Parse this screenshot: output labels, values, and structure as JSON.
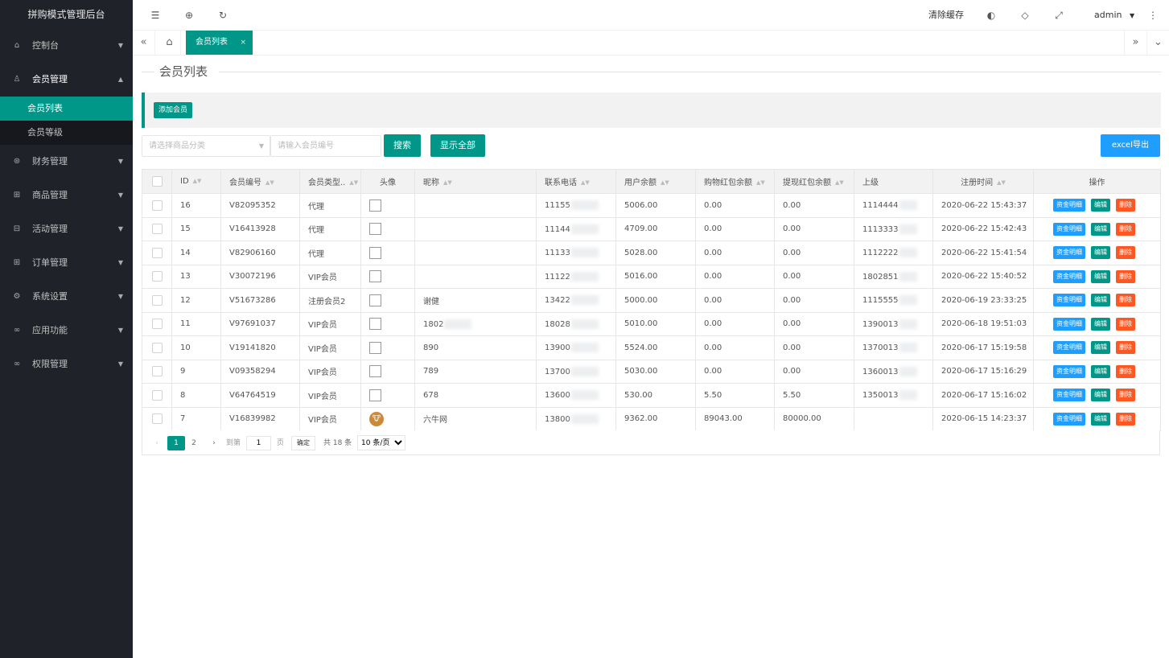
{
  "app_title": "拼购模式管理后台",
  "sidebar": {
    "items": [
      {
        "label": "控制台",
        "icon": "⌂"
      },
      {
        "label": "会员管理",
        "icon": "♙"
      },
      {
        "label": "财务管理",
        "icon": "⊛"
      },
      {
        "label": "商品管理",
        "icon": "⊞"
      },
      {
        "label": "活动管理",
        "icon": "⊟"
      },
      {
        "label": "订单管理",
        "icon": "⊞"
      },
      {
        "label": "系统设置",
        "icon": "⚙"
      },
      {
        "label": "应用功能",
        "icon": "∞"
      },
      {
        "label": "权限管理",
        "icon": "∞"
      }
    ],
    "submenu": [
      "会员列表",
      "会员等级"
    ]
  },
  "topbar": {
    "clear_cache": "清除缓存",
    "user": "admin",
    "menu_icon": "☰",
    "globe_icon": "⊕",
    "refresh_icon": "↻"
  },
  "tabs": {
    "active": "会员列表",
    "close": "×"
  },
  "page": {
    "title": "会员列表",
    "add_button": "添加会员",
    "category_placeholder": "请选择商品分类",
    "member_placeholder": "请输入会员编号",
    "search_button": "搜索",
    "show_all_button": "显示全部",
    "export_button": "excel导出"
  },
  "table": {
    "headers": [
      "ID",
      "会员编号",
      "会员类型..",
      "头像",
      "昵称",
      "联系电话",
      "用户余额",
      "购物红包余额",
      "提现红包余额",
      "上级",
      "注册时间",
      "操作"
    ],
    "rows": [
      {
        "id": "16",
        "code": "V82095352",
        "type": "代理",
        "avatar": "box",
        "nick": "",
        "phone": "11155",
        "balance": "5006.00",
        "shop": "0.00",
        "cash": "0.00",
        "parent": "1114444",
        "time": "2020-06-22 15:43:37"
      },
      {
        "id": "15",
        "code": "V16413928",
        "type": "代理",
        "avatar": "box",
        "nick": "",
        "phone": "11144",
        "balance": "4709.00",
        "shop": "0.00",
        "cash": "0.00",
        "parent": "1113333",
        "time": "2020-06-22 15:42:43"
      },
      {
        "id": "14",
        "code": "V82906160",
        "type": "代理",
        "avatar": "box",
        "nick": "",
        "phone": "11133",
        "balance": "5028.00",
        "shop": "0.00",
        "cash": "0.00",
        "parent": "1112222",
        "time": "2020-06-22 15:41:54"
      },
      {
        "id": "13",
        "code": "V30072196",
        "type": "VIP会员",
        "avatar": "box",
        "nick": "",
        "phone": "11122",
        "balance": "5016.00",
        "shop": "0.00",
        "cash": "0.00",
        "parent": "1802851",
        "time": "2020-06-22 15:40:52"
      },
      {
        "id": "12",
        "code": "V51673286",
        "type": "注册会员2",
        "avatar": "box",
        "nick": "谢健",
        "phone": "13422",
        "balance": "5000.00",
        "shop": "0.00",
        "cash": "0.00",
        "parent": "1115555",
        "time": "2020-06-19 23:33:25"
      },
      {
        "id": "11",
        "code": "V97691037",
        "type": "VIP会员",
        "avatar": "box",
        "nick": "1802",
        "phone": "18028",
        "balance": "5010.00",
        "shop": "0.00",
        "cash": "0.00",
        "parent": "1390013",
        "time": "2020-06-18 19:51:03"
      },
      {
        "id": "10",
        "code": "V19141820",
        "type": "VIP会员",
        "avatar": "box",
        "nick": "890",
        "phone": "13900",
        "balance": "5524.00",
        "shop": "0.00",
        "cash": "0.00",
        "parent": "1370013",
        "time": "2020-06-17 15:19:58"
      },
      {
        "id": "9",
        "code": "V09358294",
        "type": "VIP会员",
        "avatar": "box",
        "nick": "789",
        "phone": "13700",
        "balance": "5030.00",
        "shop": "0.00",
        "cash": "0.00",
        "parent": "1360013",
        "time": "2020-06-17 15:16:29"
      },
      {
        "id": "8",
        "code": "V64764519",
        "type": "VIP会员",
        "avatar": "box",
        "nick": "678",
        "phone": "13600",
        "balance": "530.00",
        "shop": "5.50",
        "cash": "5.50",
        "parent": "1350013",
        "time": "2020-06-17 15:16:02"
      },
      {
        "id": "7",
        "code": "V16839982",
        "type": "VIP会员",
        "avatar": "ox",
        "nick": "六牛网",
        "phone": "13800",
        "balance": "9362.00",
        "shop": "89043.00",
        "cash": "80000.00",
        "parent": "",
        "time": "2020-06-15 14:23:37"
      }
    ],
    "actions": [
      "资金明细",
      "编辑",
      "删除"
    ]
  },
  "pager": {
    "prev": "‹",
    "pages": [
      "1",
      "2"
    ],
    "next": "›",
    "goto": "到第",
    "page_value": "1",
    "page_unit": "页",
    "confirm": "确定",
    "total": "共 18 条",
    "per_page": "10 条/页"
  }
}
